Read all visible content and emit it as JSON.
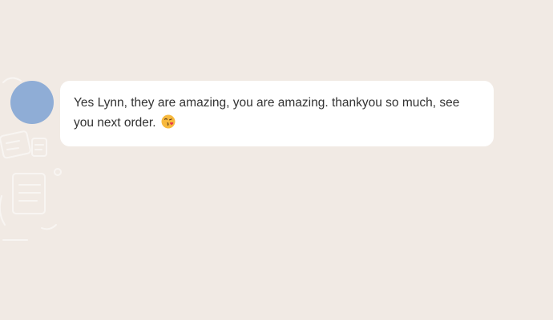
{
  "background_color": "#f1eae4",
  "message": {
    "avatar_color": "#8fadd6",
    "text": "Yes Lynn, they are amazing, you are amazing. thankyou so much, see you next order.",
    "emoji": "face-blowing-a-kiss"
  }
}
